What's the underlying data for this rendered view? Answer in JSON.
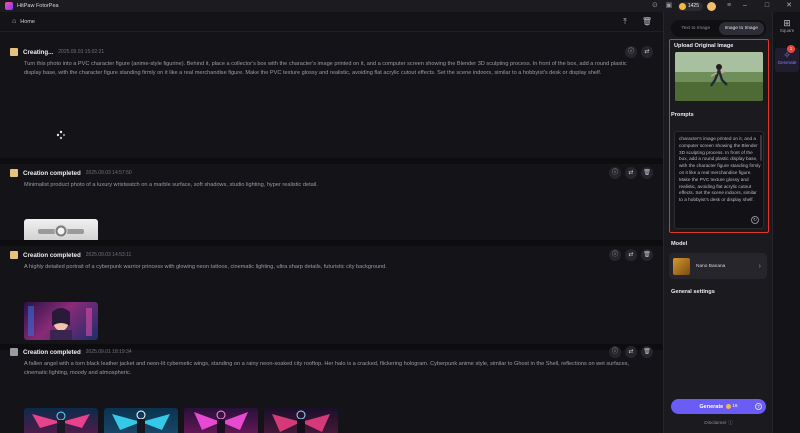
{
  "titlebar": {
    "app_title": "HitPaw FotorPea",
    "credits": "1425",
    "icons": [
      "gamepad-icon",
      "gift-icon",
      "coin-icon",
      "avatar",
      "menu-icon",
      "minimize-icon",
      "maximize-icon",
      "close-icon"
    ]
  },
  "home": {
    "label": "Home",
    "icon": "home-icon"
  },
  "feed": [
    {
      "status": "Creating...",
      "time": "2025.09.03   15:02:21",
      "prompt": "Turn this photo into a PVC character figure (anime-style figurine). Behind it, place a collector's box with the character's image printed on it, and a computer screen showing the Blender 3D sculpting process. In front of the box, add a round plastic display base, with the character figure standing firmly on it like a real merchandise figure. Make the PVC texture glossy and realistic, avoiding flat acrylic cutout effects. Set the scene indoors, similar to a hobbyist's desk or display shelf."
    },
    {
      "status": "Creation completed",
      "time": "2025.09.03   14:57:50",
      "prompt": "Minimalist product photo of a luxury wristwatch on a marble surface, soft shadows, studio lighting, hyper realistic detail."
    },
    {
      "status": "Creation completed",
      "time": "2025.09.03   14:53:11",
      "prompt": "A highly detailed portrait of a cyberpunk warrior princess with glowing neon tattoos, cinematic lighting, ultra sharp details, futuristic city background."
    },
    {
      "status": "Creation completed",
      "time": "2025.09.01   18:19:34",
      "prompt": "A fallen angel with a torn black leather jacket and neon-lit cybernetic wings, standing on a rainy neon-soaked city rooftop. Her halo is a cracked, flickering hologram. Cyberpunk anime style, similar to Ghost in the Shell, reflections on wet surfaces, cinematic lighting, moody and atmospheric."
    }
  ],
  "side": {
    "tabs": [
      "Text to Image",
      "Image to Image"
    ],
    "active_tab": "Image to Image",
    "upload_title": "Upload Original Image",
    "prompts_title": "Prompts",
    "prompt_text": "character's image printed on it, and a computer screen showing the Blender 3D sculpting process. In front of the box, add a round plastic display base, with the character figure standing firmly on it like a real merchandise figure. Make the PVC texture glossy and realistic, avoiding flat acrylic cutout effects. Set the scene indoors, similar to a hobbyist's desk or display shelf.",
    "model_title": "Model",
    "model_name": "Nano Banana",
    "general_settings": "General settings",
    "generate_label": "Generate",
    "generate_cost": "16",
    "disclaimer": "Disclaimer"
  },
  "rail": {
    "items": [
      {
        "label": "Square",
        "icon": "grid-icon"
      },
      {
        "label": "Generate",
        "icon": "sparkle-icon",
        "badge": "1"
      }
    ]
  },
  "colors": {
    "accent": "#6c5cf6",
    "highlight": "#e0352b",
    "bg": "#141418",
    "panel": "#1a1a1f"
  }
}
